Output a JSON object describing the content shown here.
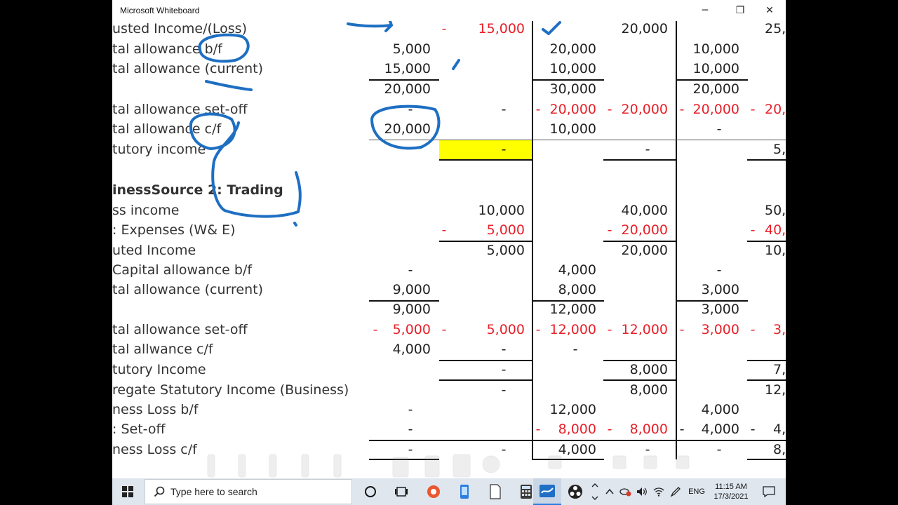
{
  "window": {
    "title": "Microsoft Whiteboard",
    "minimize_glyph": "─",
    "restore_glyph": "❐",
    "close_glyph": "✕"
  },
  "sheet": {
    "labels": [
      "usted Income/(Loss)",
      "tal  allowance b/f",
      "tal allowance (current)",
      "tal allowance set-off",
      "tal allowance c/f",
      "tutory income",
      "inessSource 2: Trading",
      "ss income",
      ": Expenses (W& E)",
      "uted Income",
      " Capital allowance b/f",
      "tal allowance (current)",
      "tal allowance set-off",
      "tal allwance c/f",
      "tutory Income",
      "regate Statutory Income (Business)",
      "ness Loss b/f",
      ": Set-off",
      "ness Loss c/f"
    ],
    "cells": {
      "r0": [
        "-",
        "15,000",
        "20,000",
        "25,"
      ],
      "r1": [
        "5,000",
        "20,000",
        "10,000"
      ],
      "r2": [
        "15,000",
        "10,000",
        "10,000"
      ],
      "r3": [
        "20,000",
        "30,000",
        "20,000"
      ],
      "r4": [
        "-",
        "-",
        "-",
        "20,000",
        "-",
        "20,000",
        "-",
        "20,000",
        "-",
        "20,"
      ],
      "r5": [
        "20,000",
        "10,000",
        "-"
      ],
      "r6": [
        "-",
        "-",
        "5,"
      ],
      "r8": [
        "10,000",
        "40,000",
        "50,"
      ],
      "r9": [
        "-",
        "5,000",
        "-",
        "20,000",
        "-",
        "40,"
      ],
      "r10": [
        "5,000",
        "20,000",
        "10,"
      ],
      "r11": [
        "-",
        "4,000",
        "-"
      ],
      "r12": [
        "9,000",
        "8,000",
        "3,000"
      ],
      "r13": [
        "9,000",
        "12,000",
        "3,000"
      ],
      "r14": [
        "-",
        "5,000",
        "-",
        "5,000",
        "-",
        "12,000",
        "-",
        "12,000",
        "-",
        "3,000",
        "-",
        "3,"
      ],
      "r15": [
        "4,000",
        "-",
        "-"
      ],
      "r16": [
        "-",
        "8,000",
        "7,"
      ],
      "r17": [
        "-",
        "8,000",
        "12,"
      ],
      "r18": [
        "-",
        "12,000",
        "4,000"
      ],
      "r19": [
        "-",
        "-",
        "8,000",
        "-",
        "8,000",
        "-",
        "4,000",
        "-",
        "4,"
      ],
      "r20": [
        "-",
        "-",
        "4,000",
        "-",
        "-",
        "8,"
      ]
    }
  },
  "taskbar": {
    "search_placeholder": "Type here to search",
    "language": "ENG",
    "time": "11:15 AM",
    "date": "17/3/2021"
  },
  "colors": {
    "ink_blue": "#1e6fc2",
    "red_text": "#e8202a",
    "highlight_yellow": "#ffff00",
    "taskbar_bg": "#dfe6ee"
  }
}
